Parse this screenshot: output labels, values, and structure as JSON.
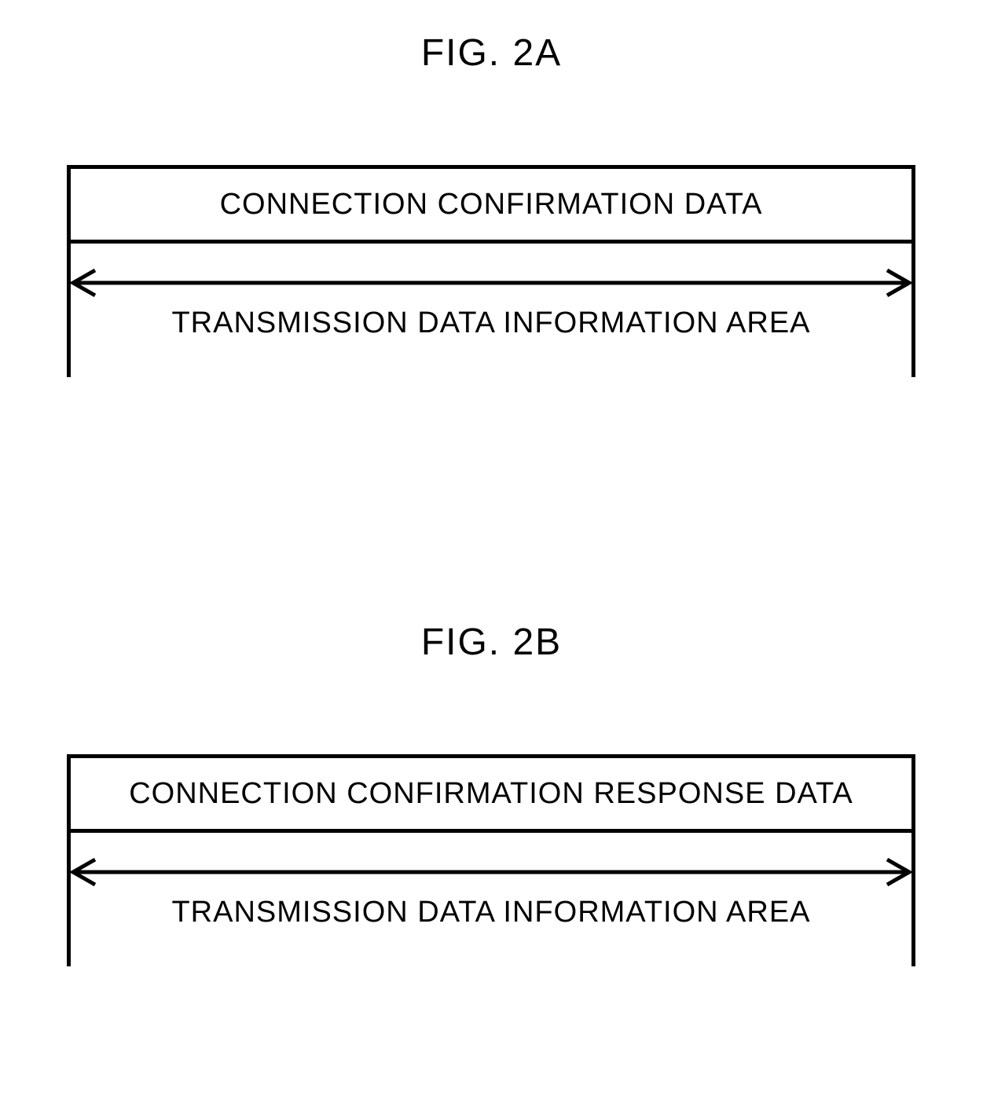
{
  "figures": {
    "a": {
      "title": "FIG. 2A",
      "box_label": "CONNECTION CONFIRMATION DATA",
      "extent_label": "TRANSMISSION DATA INFORMATION AREA"
    },
    "b": {
      "title": "FIG. 2B",
      "box_label": "CONNECTION CONFIRMATION RESPONSE DATA",
      "extent_label": "TRANSMISSION DATA INFORMATION AREA"
    }
  }
}
